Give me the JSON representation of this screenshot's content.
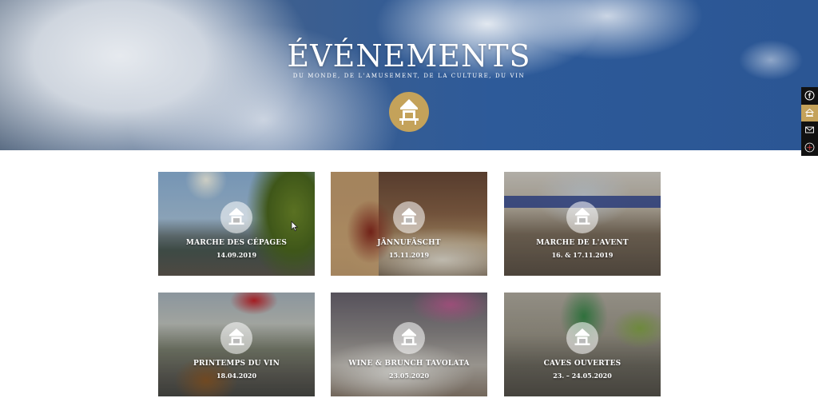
{
  "hero": {
    "title": "ÉVÉNEMENTS",
    "subtitle": "DU MONDE, DE L'AMUSEMENT, DE LA CULTURE, DU VIN",
    "logo_icon": "pavilion-logo-icon"
  },
  "social": {
    "items": [
      {
        "icon": "facebook-icon"
      },
      {
        "icon": "pavilion-icon"
      },
      {
        "icon": "mail-icon"
      },
      {
        "icon": "flower-icon"
      }
    ]
  },
  "colors": {
    "accent_gold": "#c4a25a",
    "social_bg": "#111111"
  },
  "events": [
    {
      "title": "MARCHE DES CÉPAGES",
      "date": "14.09.2019"
    },
    {
      "title": "JÄNNUFÄSCHT",
      "date": "15.11.2019"
    },
    {
      "title": "MARCHE DE L'AVENT",
      "date": "16. & 17.11.2019"
    },
    {
      "title": "PRINTEMPS DU VIN",
      "date": "18.04.2020"
    },
    {
      "title": "WINE & BRUNCH TAVOLATA",
      "date": "23.05.2020"
    },
    {
      "title": "CAVES OUVERTES",
      "date": "23. – 24.05.2020"
    }
  ]
}
